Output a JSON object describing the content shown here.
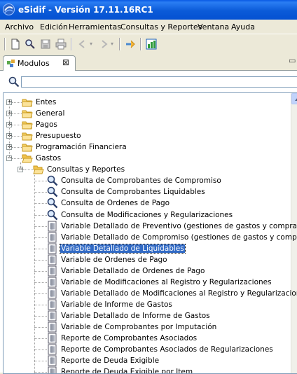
{
  "window": {
    "title": "eSidif - Versión 17.11.16RC1"
  },
  "menu": [
    {
      "label": "Archivo"
    },
    {
      "label": "Edición"
    },
    {
      "label": "Herramientas"
    },
    {
      "label": "Consultas y Reportes"
    },
    {
      "label": "Ventana"
    },
    {
      "label": "Ayuda"
    }
  ],
  "tab": {
    "label": "Modulos",
    "close": "⊠"
  },
  "search": {
    "value": ""
  },
  "tree": {
    "folders": [
      {
        "label": "Entes",
        "expanded": false
      },
      {
        "label": "General",
        "expanded": false
      },
      {
        "label": "Pagos",
        "expanded": false
      },
      {
        "label": "Presupuesto",
        "expanded": false
      },
      {
        "label": "Programación Financiera",
        "expanded": false
      },
      {
        "label": "Gastos",
        "expanded": true
      }
    ],
    "subfolder": {
      "label": "Consultas y Reportes",
      "expanded": true
    },
    "items": [
      {
        "label": "Consulta de Comprobantes de Compromiso",
        "icon": "search-doc-icon"
      },
      {
        "label": "Consulta de Comprobantes Liquidables",
        "icon": "search-doc-icon"
      },
      {
        "label": "Consulta de Ordenes de Pago",
        "icon": "search-doc-icon"
      },
      {
        "label": "Consulta de Modificaciones y Regularizaciones",
        "icon": "search-doc-icon"
      },
      {
        "label": "Variable Detallado de Preventivo (gestiones de gastos y compras)",
        "icon": "report-icon"
      },
      {
        "label": "Variable Detallado de Compromiso (gestiones de gastos y compras)",
        "icon": "report-icon"
      },
      {
        "label": "Variable Detallado de Liquidables",
        "icon": "report-icon",
        "selected": true
      },
      {
        "label": "Variable de Ordenes de Pago",
        "icon": "report-icon"
      },
      {
        "label": "Variable Detallado de Ordenes de Pago",
        "icon": "report-icon"
      },
      {
        "label": "Variable de Modificaciones al Registro y Regularizaciones",
        "icon": "report-icon"
      },
      {
        "label": "Variable Detallado de Modificaciones al Registro y Regularizaciones",
        "icon": "report-icon"
      },
      {
        "label": "Variable de Informe de Gastos",
        "icon": "report-icon"
      },
      {
        "label": "Variable Detallado de Informe de Gastos",
        "icon": "report-icon"
      },
      {
        "label": "Variable de Comprobantes por Imputación",
        "icon": "report-icon"
      },
      {
        "label": "Reporte de Comprobantes Asociados",
        "icon": "report-icon"
      },
      {
        "label": "Reporte de Comprobantes Asociados de Regularizaciones",
        "icon": "report-icon"
      },
      {
        "label": "Reporte de Deuda Exigible",
        "icon": "report-icon"
      },
      {
        "label": "Reporte de Deuda Exigible por Item",
        "icon": "report-icon"
      }
    ]
  },
  "colors": {
    "titlebar": "#0b5bd8",
    "selection": "#316ac5",
    "folder": "#f5c542"
  }
}
